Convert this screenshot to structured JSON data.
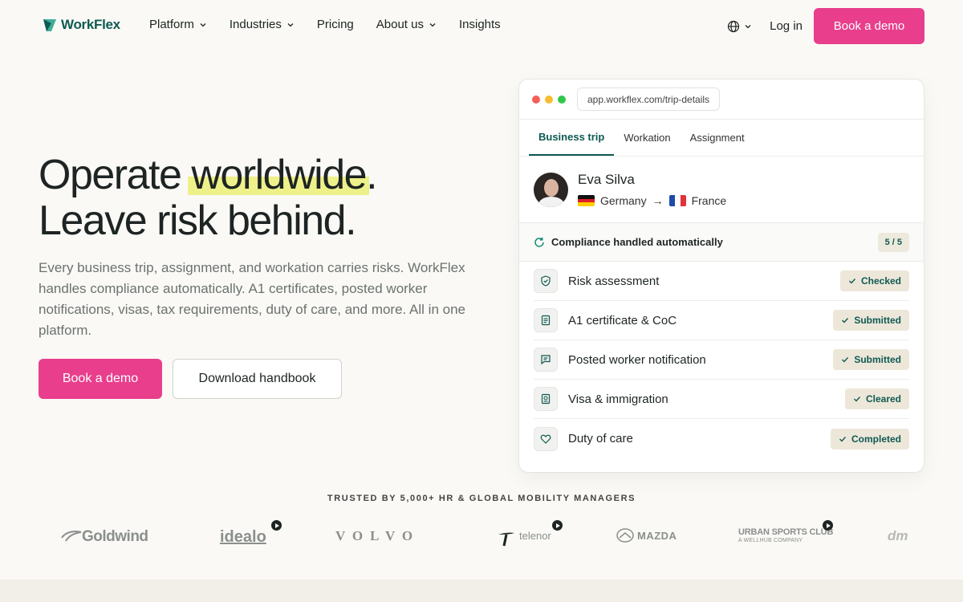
{
  "nav": {
    "logo": "WorkFlex",
    "links": [
      {
        "label": "Platform",
        "dropdown": true
      },
      {
        "label": "Industries",
        "dropdown": true
      },
      {
        "label": "Pricing",
        "dropdown": false
      },
      {
        "label": "About us",
        "dropdown": true
      },
      {
        "label": "Insights",
        "dropdown": false
      }
    ],
    "login": "Log in",
    "cta": "Book a demo"
  },
  "hero": {
    "title_before": "Operate ",
    "title_highlight": "worldwide",
    "title_after": ".",
    "title_line2": "Leave risk behind.",
    "subtitle": "Every business trip, assignment, and workation carries risks. WorkFlex handles compliance automatically. A1 certificates, posted worker notifications, visas, tax requirements, duty of care, and more. All in one platform.",
    "cta_primary": "Book a demo",
    "cta_secondary": "Download handbook"
  },
  "card": {
    "url": "app.workflex.com/trip-details",
    "tabs": [
      {
        "label": "Business trip",
        "active": true
      },
      {
        "label": "Workation",
        "active": false
      },
      {
        "label": "Assignment",
        "active": false
      }
    ],
    "person": {
      "name": "Eva Silva",
      "from": "Germany",
      "arrow": "→",
      "to": "France"
    },
    "compliance_label": "Compliance handled automatically",
    "compliance_count": "5 / 5",
    "items": [
      {
        "label": "Risk assessment",
        "status": "Checked",
        "icon": "shield-icon"
      },
      {
        "label": "A1 certificate & CoC",
        "status": "Submitted",
        "icon": "document-icon"
      },
      {
        "label": "Posted worker notification",
        "status": "Submitted",
        "icon": "message-icon"
      },
      {
        "label": "Visa & immigration",
        "status": "Cleared",
        "icon": "passport-icon"
      },
      {
        "label": "Duty of care",
        "status": "Completed",
        "icon": "heart-icon"
      }
    ]
  },
  "trusted": "TRUSTED BY 5,000+ HR & GLOBAL MOBILITY MANAGERS",
  "logos": [
    "Goldwind",
    "idealo",
    "VOLVO",
    "telenor",
    "MAZDA",
    "URBAN SPORTS CLUB",
    "A WELLHUB COMPANY",
    "dm"
  ],
  "colors": {
    "brand_pink": "#e83e8c",
    "brand_teal": "#0f5a52",
    "highlight": "#eef08a"
  }
}
